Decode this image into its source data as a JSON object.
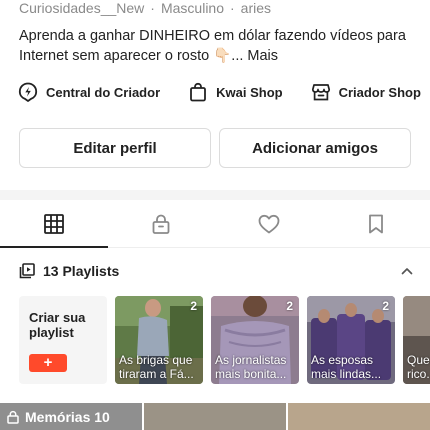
{
  "profile": {
    "username": "Curiosidades__New",
    "gender": "Masculino",
    "sign": "aries",
    "bio": "Aprenda a ganhar DINHEIRO em dólar fazendo vídeos para Internet sem aparecer o rosto 👇🏻...",
    "bio_more": "Mais"
  },
  "links": [
    {
      "label": "Central do Criador",
      "icon": "lightning-icon"
    },
    {
      "label": "Kwai Shop",
      "icon": "shopping-bag-icon"
    },
    {
      "label": "Criador Shop",
      "icon": "storefront-icon"
    }
  ],
  "buttons": {
    "edit_profile": "Editar perfil",
    "add_friends": "Adicionar amigos"
  },
  "tabs": [
    {
      "icon": "grid-icon",
      "active": true
    },
    {
      "icon": "lock-icon",
      "active": false
    },
    {
      "icon": "heart-icon",
      "active": false
    },
    {
      "icon": "bookmark-icon",
      "active": false
    }
  ],
  "playlists": {
    "title": "13 Playlists",
    "create_label": "Criar sua playlist",
    "create_button": "+",
    "items": [
      {
        "count": "2",
        "caption_1": "As brigas que",
        "caption_2": "tiraram a Fá..."
      },
      {
        "count": "2",
        "caption_1": "As jornalistas",
        "caption_2": "mais bonita..."
      },
      {
        "count": "2",
        "caption_1": "As esposas",
        "caption_2": "mais lindas..."
      },
      {
        "count": "",
        "caption_1": "Que",
        "caption_2": "rico..."
      }
    ]
  },
  "memories": {
    "label": "Memórias 10"
  },
  "colors": {
    "accent": "#ff4a2b",
    "text": "#222222",
    "muted": "#8a8a8a"
  }
}
